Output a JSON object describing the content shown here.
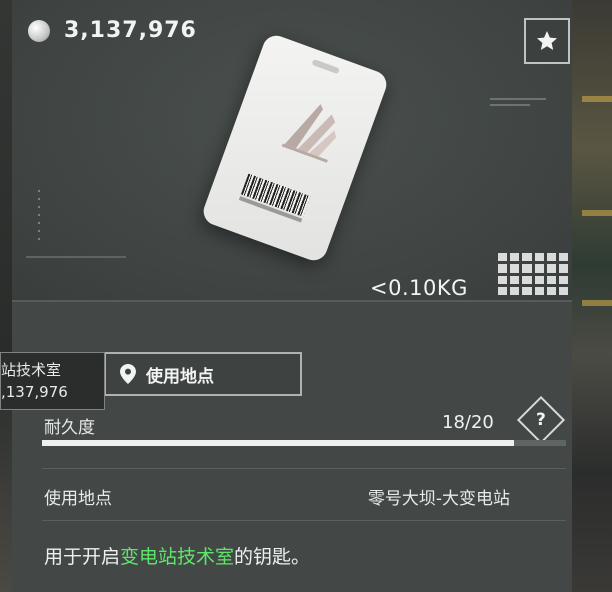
{
  "header": {
    "currency_icon": "silver-coin-icon",
    "currency_value": "3,137,976",
    "favorite_icon": "star-icon"
  },
  "item": {
    "image_icon": "keycard-icon",
    "weight": "<0.10KG",
    "size_icon": "inventory-grid-icon"
  },
  "tooltip": {
    "title": "站技术室",
    "value": ",137,976"
  },
  "use_location_button": {
    "icon": "location-pin-icon",
    "label": "使用地点"
  },
  "durability": {
    "label": "耐久度",
    "value_text": "18/20",
    "current": 18,
    "max": 20,
    "help_label": "?"
  },
  "location": {
    "label": "使用地点",
    "value": "零号大坝-大变电站"
  },
  "description": {
    "prefix": "用于开启",
    "highlight": "变电站技术室",
    "suffix": "的钥匙。",
    "highlight_color": "#5ee66b"
  }
}
